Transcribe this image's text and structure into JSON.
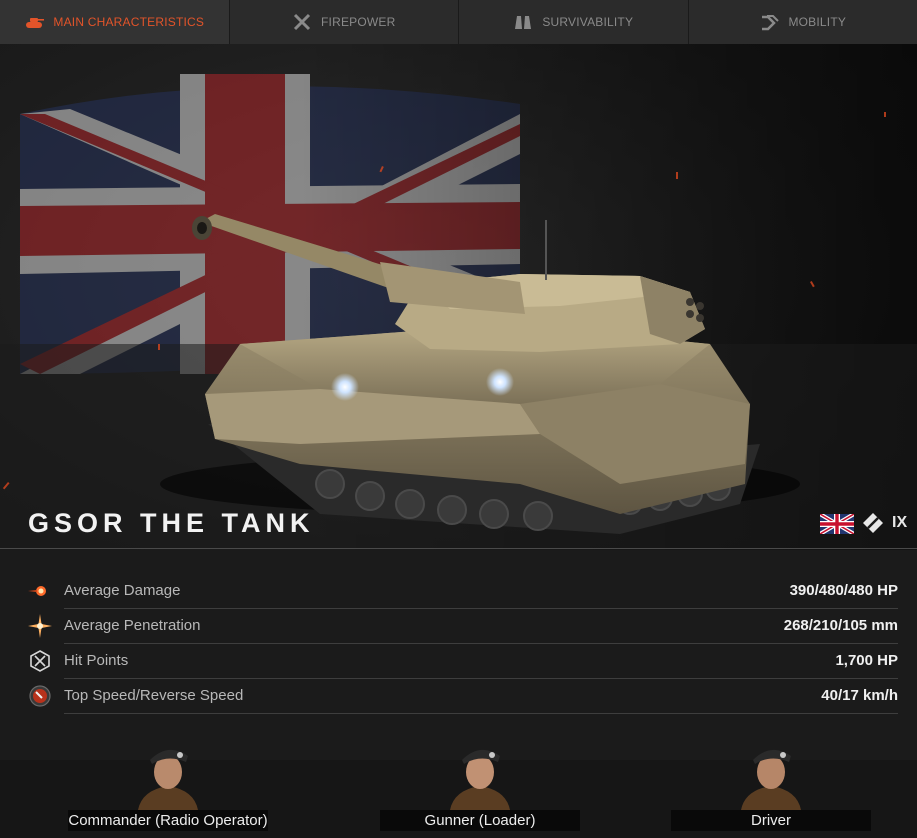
{
  "tabs": [
    {
      "label": "MAIN CHARACTERISTICS",
      "icon": "tank-icon",
      "active": true
    },
    {
      "label": "FIREPOWER",
      "icon": "crossed-guns-icon",
      "active": false
    },
    {
      "label": "SURVIVABILITY",
      "icon": "armor-icon",
      "active": false
    },
    {
      "label": "MOBILITY",
      "icon": "track-icon",
      "active": false
    }
  ],
  "vehicle": {
    "name": "GSOR THE TANK",
    "nation_flag": "uk-flag-icon",
    "class_icon": "medium-tank-class-icon",
    "tier": "IX"
  },
  "stats": [
    {
      "label": "Average Damage",
      "value": "390/480/480 HP",
      "icon": "damage-icon"
    },
    {
      "label": "Average Penetration",
      "value": "268/210/105 mm",
      "icon": "penetration-icon"
    },
    {
      "label": "Hit Points",
      "value": "1,700 HP",
      "icon": "hit-points-icon"
    },
    {
      "label": "Top Speed/Reverse Speed",
      "value": "40/17 km/h",
      "icon": "speed-icon"
    }
  ],
  "crew": [
    {
      "role": "Commander (Radio Operator)"
    },
    {
      "role": "Gunner (Loader)"
    },
    {
      "role": "Driver"
    }
  ],
  "colors": {
    "accent": "#e2542a",
    "background": "#1b1b1b",
    "tab_bg": "#2b2b2b"
  }
}
